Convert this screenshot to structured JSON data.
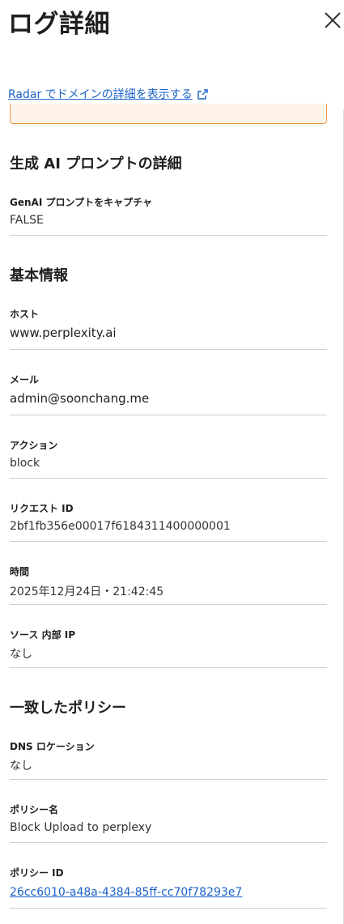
{
  "header": {
    "title": "ログ詳細",
    "radar_link": "Radar でドメインの詳細を表示する"
  },
  "genai": {
    "section_title": "生成 AI プロンプトの詳細",
    "capture_label": "GenAI プロンプトをキャプチャ",
    "capture_value": "FALSE"
  },
  "basic": {
    "section_title": "基本情報",
    "host_label": "ホスト",
    "host_value": "www.perplexity.ai",
    "email_label": "メール",
    "email_value": "admin@soonchang.me",
    "action_label": "アクション",
    "action_value": "block",
    "request_id_label": "リクエスト ID",
    "request_id_value": "2bf1fb356e00017f6184311400000001",
    "time_label": "時間",
    "time_value": "2025年12月24日・21:42:45",
    "source_ip_label": "ソース 内部 IP",
    "source_ip_value": "なし"
  },
  "policy": {
    "section_title": "一致したポリシー",
    "dns_location_label": "DNS ロケーション",
    "dns_location_value": "なし",
    "policy_name_label": "ポリシー名",
    "policy_name_value": "Block Upload to perplexy",
    "policy_id_label": "ポリシー ID",
    "policy_id_value": "26cc6010-a48a-4384-85ff-cc70f78293e7"
  },
  "icons": {
    "close": "close-icon",
    "external_link": "external-link-icon"
  },
  "colors": {
    "link": "#1b62c9",
    "warning_border": "#e49a4e",
    "warning_bg": "#fdf3e7"
  }
}
